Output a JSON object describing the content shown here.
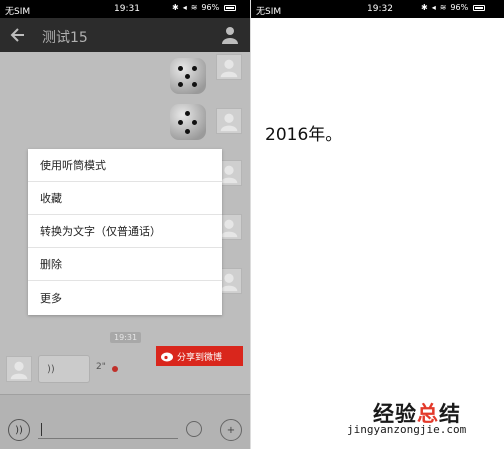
{
  "left_screen": {
    "status_bar": {
      "carrier": "无SIM",
      "time": "19:31",
      "battery": "96%"
    },
    "header": {
      "title": "测试15"
    },
    "context_menu": {
      "items": [
        {
          "label": "使用听筒模式"
        },
        {
          "label": "收藏"
        },
        {
          "label": "转换为文字（仅普通话）"
        },
        {
          "label": "删除"
        },
        {
          "label": "更多"
        }
      ]
    },
    "chat": {
      "timestamp": "19:31",
      "voice_message": {
        "icon_text": "))",
        "duration": "2\""
      },
      "share_button": {
        "label": "分享到微博",
        "color": "#d9261c"
      }
    }
  },
  "right_screen": {
    "status_bar": {
      "carrier": "无SIM",
      "time": "19:32",
      "battery": "96%"
    },
    "content": {
      "text": "2016年。"
    },
    "watermark": {
      "title_part1": "经验",
      "title_part2": "总",
      "title_part3": "结",
      "url": "jingyanzongjie.com"
    }
  }
}
